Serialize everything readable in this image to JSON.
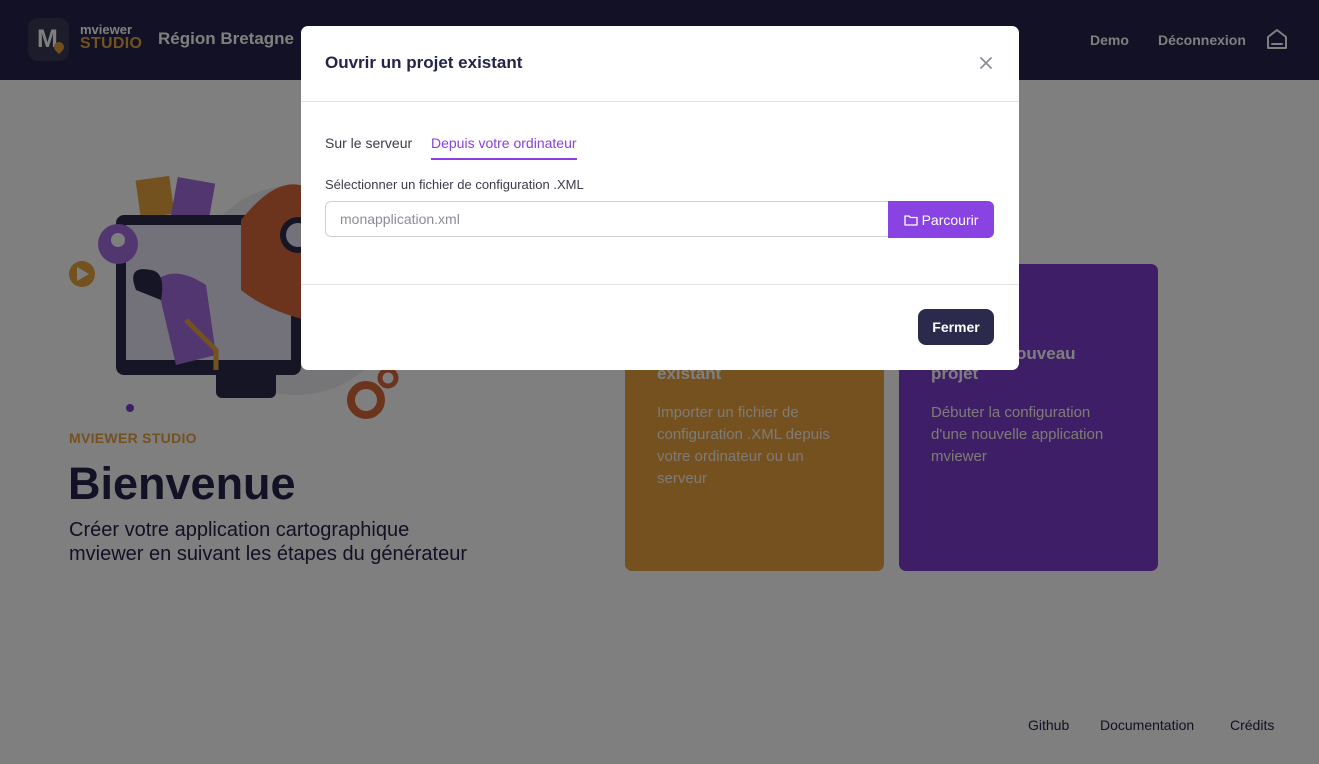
{
  "header": {
    "logo_line1": "mviewer",
    "logo_line2": "STUDIO",
    "org_name": "Région Bretagne",
    "nav": [
      {
        "label": "Demo"
      },
      {
        "label": "Déconnexion"
      }
    ],
    "home_icon": "home-icon"
  },
  "hero": {
    "eyebrow": "MVIEWER STUDIO",
    "title": "Bienvenue",
    "subtitle": "Créer votre application cartographique mviewer en suivant les étapes du générateur"
  },
  "cards": [
    {
      "title": "Ouvrir un projet existant",
      "description": "Importer un fichier de configuration .XML depuis votre ordinateur ou un serveur",
      "color": "#e9a23e"
    },
    {
      "title": "Créer un nouveau projet",
      "description": "Débuter la configuration d'une nouvelle application mviewer",
      "color": "#7c3ccf"
    }
  ],
  "footer": {
    "links": [
      {
        "label": "Github"
      },
      {
        "label": "Documentation"
      },
      {
        "label": "Crédits"
      }
    ]
  },
  "modal": {
    "title": "Ouvrir un projet existant",
    "tabs": [
      {
        "label": "Sur le serveur",
        "active": false
      },
      {
        "label": "Depuis votre ordinateur",
        "active": true
      }
    ],
    "field_label": "Sélectionner un fichier de configuration .XML",
    "file_placeholder": "monapplication.xml",
    "browse_label": "Parcourir",
    "close_label": "Fermer"
  },
  "colors": {
    "header_bg": "#24234a",
    "accent_orange": "#e6a440",
    "accent_purple": "#8a43e3",
    "overlay": "rgba(0,0,0,0.5)"
  }
}
